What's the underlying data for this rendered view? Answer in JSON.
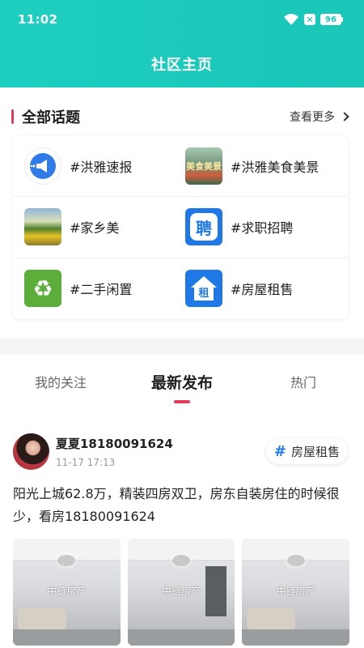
{
  "status_bar": {
    "time": "11:02",
    "battery": "96"
  },
  "header": {
    "title": "社区主页"
  },
  "topics": {
    "title": "全部话题",
    "see_more": "查看更多",
    "items": [
      {
        "label": "#洪雅速报",
        "icon": "megaphone-icon"
      },
      {
        "label": "#洪雅美食美景",
        "icon": "food-scenery-icon",
        "icon_text": "美食美景"
      },
      {
        "label": "#家乡美",
        "icon": "hometown-landscape-icon"
      },
      {
        "label": "#求职招聘",
        "icon": "recruit-icon",
        "icon_text": "聘"
      },
      {
        "label": "#二手闲置",
        "icon": "recycle-icon"
      },
      {
        "label": "#房屋租售",
        "icon": "house-rent-icon",
        "icon_text": "租"
      }
    ]
  },
  "tabs": [
    {
      "label": "我的关注",
      "active": false
    },
    {
      "label": "最新发布",
      "active": true
    },
    {
      "label": "热门",
      "active": false
    }
  ],
  "post": {
    "username": "夏夏18180091624",
    "time": "11-17 17:13",
    "topic_tag": "房屋租售",
    "text": "阳光上城62.8万，精装四房双卫，房东自装房住的时候很少，看房18180091624",
    "photos": [
      {
        "watermark": "中链房产"
      },
      {
        "watermark": "中链房产"
      },
      {
        "watermark": "中链房产"
      }
    ]
  },
  "colors": {
    "header": "#1ecfc0",
    "accent": "#e33b5a",
    "link_blue": "#1e78e6"
  }
}
